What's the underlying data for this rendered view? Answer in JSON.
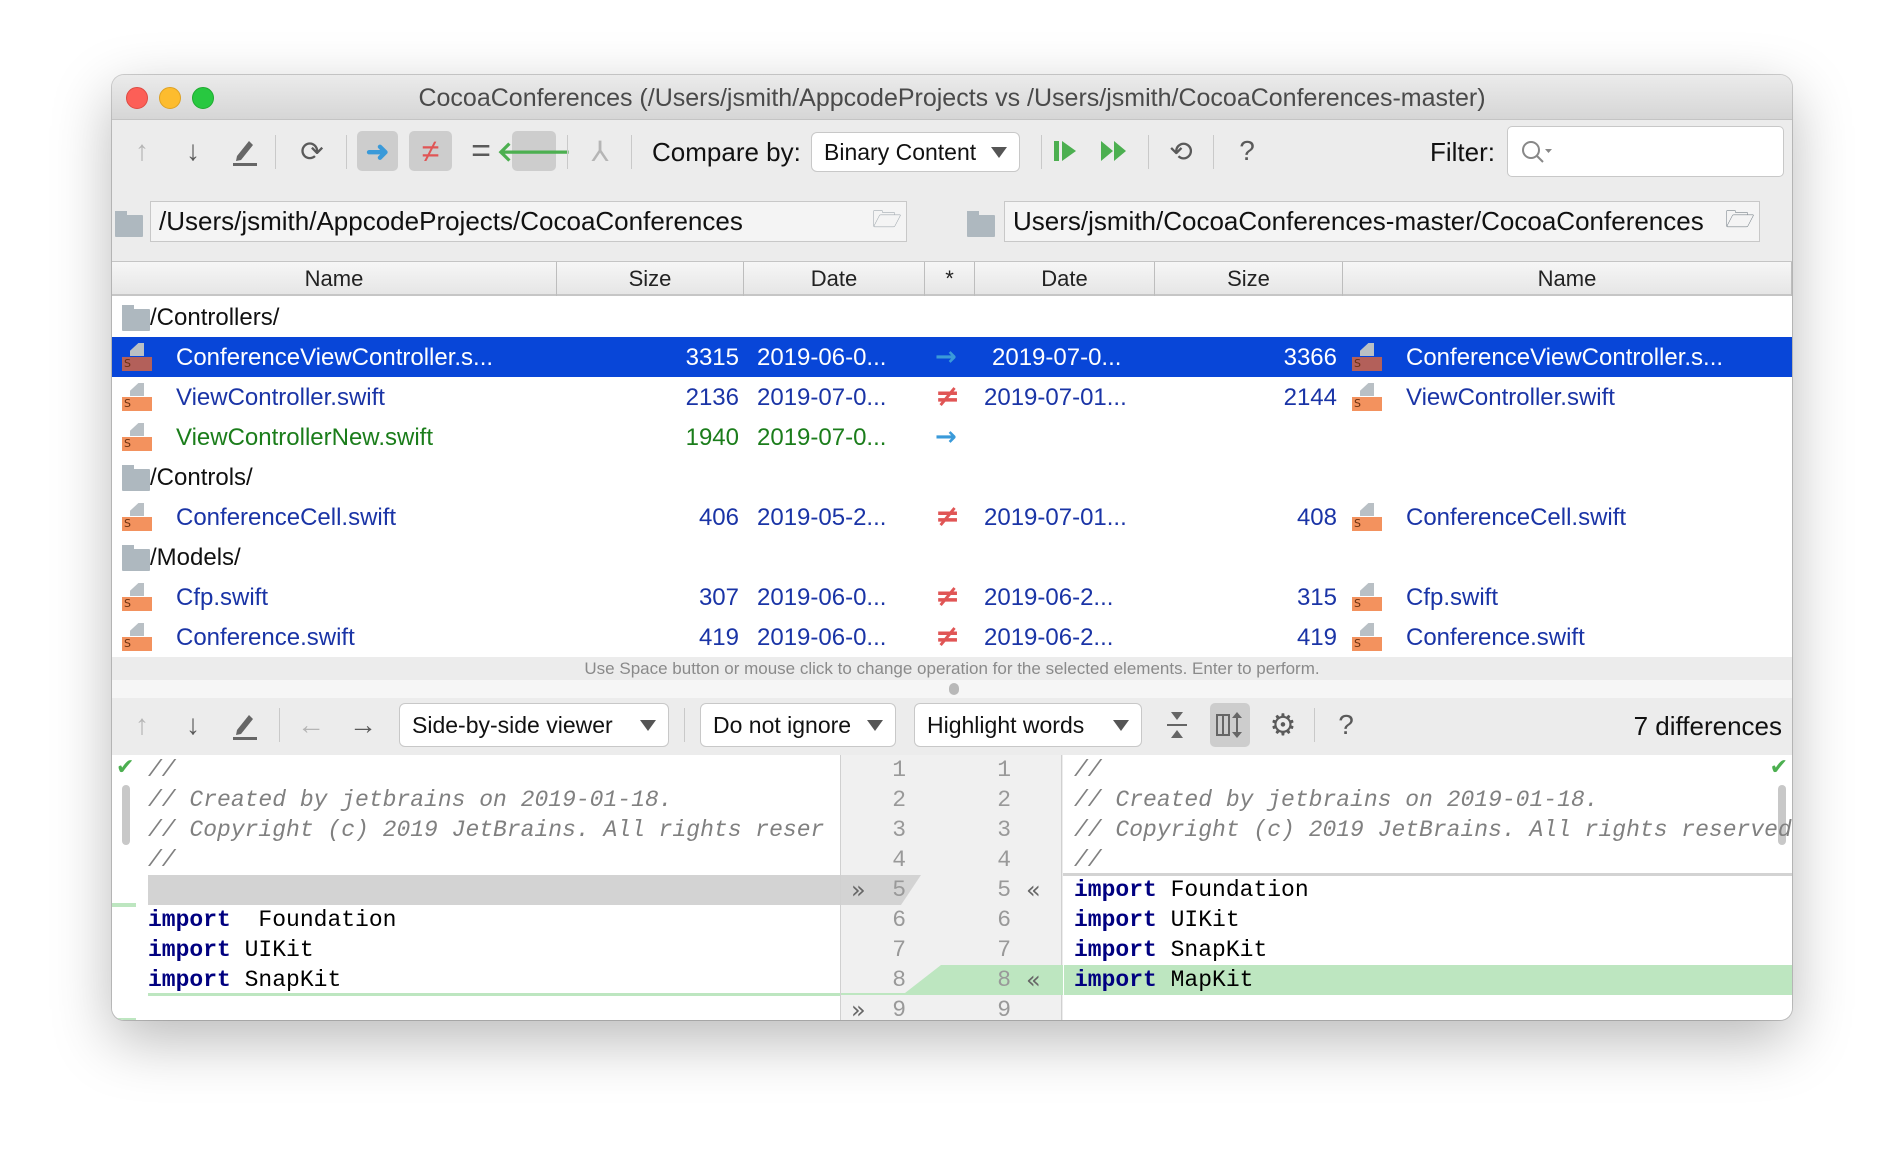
{
  "window": {
    "title": "CocoaConferences (/Users/jsmith/AppcodeProjects vs /Users/jsmith/CocoaConferences-master)"
  },
  "colors": {
    "selection": "#0846d8",
    "changed_text": "#1a34a6",
    "new_text": "#1b7d1b",
    "arrow": "#3a9ad9",
    "not_equal": "#e05555",
    "left_arrow": "#4caf50",
    "inserted_bg": "#bde6c0"
  },
  "toolbar": {
    "compare_label": "Compare by:",
    "compare_value": "Binary Content",
    "filter_label": "Filter:",
    "filter_value": "",
    "icons": [
      "arrow-up-icon",
      "arrow-down-icon",
      "edit-icon",
      "refresh-icon",
      "show-left-only-icon",
      "show-different-icon",
      "show-equal-icon",
      "show-right-only-icon",
      "merge-icon",
      "synchronize-selected-icon",
      "synchronize-all-icon",
      "compare-sync-icon",
      "help-icon"
    ]
  },
  "paths": {
    "left": "/Users/jsmith/AppcodeProjects/CocoaConferences",
    "right": "Users/jsmith/CocoaConferences-master/CocoaConferences"
  },
  "table": {
    "headers": [
      "Name",
      "Size",
      "Date",
      "*",
      "Date",
      "Size",
      "Name"
    ],
    "rows": [
      {
        "type": "folder",
        "name": "/Controllers/"
      },
      {
        "type": "file",
        "status": "selected",
        "lname": "ConferenceViewController.s...",
        "lsize": "3315",
        "ldate": "2019-06-0...",
        "op": "→",
        "rdate": "2019-07-0...",
        "rsize": "3366",
        "rname": "ConferenceViewController.s..."
      },
      {
        "type": "file",
        "status": "changed",
        "lname": "ViewController.swift",
        "lsize": "2136",
        "ldate": "2019-07-0...",
        "op": "≠",
        "rdate": "2019-07-01...",
        "rsize": "2144",
        "rname": "ViewController.swift"
      },
      {
        "type": "file",
        "status": "new",
        "lname": "ViewControllerNew.swift",
        "lsize": "1940",
        "ldate": "2019-07-0...",
        "op": "→",
        "rdate": "",
        "rsize": "",
        "rname": ""
      },
      {
        "type": "folder",
        "name": "/Controls/"
      },
      {
        "type": "file",
        "status": "changed",
        "lname": "ConferenceCell.swift",
        "lsize": "406",
        "ldate": "2019-05-2...",
        "op": "≠",
        "rdate": "2019-07-01...",
        "rsize": "408",
        "rname": "ConferenceCell.swift"
      },
      {
        "type": "folder",
        "name": "/Models/"
      },
      {
        "type": "file",
        "status": "changed",
        "lname": "Cfp.swift",
        "lsize": "307",
        "ldate": "2019-06-0...",
        "op": "≠",
        "rdate": "2019-06-2...",
        "rsize": "315",
        "rname": "Cfp.swift"
      },
      {
        "type": "file",
        "status": "changed",
        "lname": "Conference.swift",
        "lsize": "419",
        "ldate": "2019-06-0...",
        "op": "≠",
        "rdate": "2019-06-2...",
        "rsize": "419",
        "rname": "Conference.swift"
      }
    ]
  },
  "hint": "Use Space button or mouse click to change operation for the selected elements. Enter to perform.",
  "diff_toolbar": {
    "viewer": "Side-by-side viewer",
    "ignore": "Do not ignore",
    "highlight": "Highlight words",
    "differences": "7 differences"
  },
  "diff": {
    "left": [
      {
        "n": "1",
        "parts": [
          [
            "cm",
            "//"
          ]
        ]
      },
      {
        "n": "2",
        "parts": [
          [
            "cm",
            "// Created by jetbrains on 2019-01-18."
          ]
        ]
      },
      {
        "n": "3",
        "parts": [
          [
            "cm",
            "// Copyright (c) 2019 JetBrains. All rights reser"
          ]
        ]
      },
      {
        "n": "4",
        "parts": [
          [
            "cm",
            "//"
          ]
        ]
      },
      {
        "n": "5",
        "parts": [],
        "bg": "deleted"
      },
      {
        "n": "6",
        "parts": [
          [
            "kw",
            "import"
          ],
          [
            "",
            "  Foundation"
          ]
        ]
      },
      {
        "n": "7",
        "parts": [
          [
            "kw",
            "import"
          ],
          [
            "",
            " UIKit"
          ]
        ]
      },
      {
        "n": "8",
        "parts": [
          [
            "kw",
            "import"
          ],
          [
            "",
            " SnapKit"
          ]
        ]
      },
      {
        "n": "9",
        "parts": []
      }
    ],
    "right": [
      {
        "n": "1",
        "parts": [
          [
            "cm",
            "//"
          ]
        ]
      },
      {
        "n": "2",
        "parts": [
          [
            "cm",
            "// Created by jetbrains on 2019-01-18."
          ]
        ]
      },
      {
        "n": "3",
        "parts": [
          [
            "cm",
            "// Copyright (c) 2019 JetBrains. All rights reserved"
          ]
        ]
      },
      {
        "n": "4",
        "parts": [
          [
            "cm",
            "//"
          ]
        ]
      },
      {
        "n": "5",
        "parts": [
          [
            "kw",
            "import"
          ],
          [
            "",
            " Foundation"
          ]
        ]
      },
      {
        "n": "6",
        "parts": [
          [
            "kw",
            "import"
          ],
          [
            "",
            " UIKit"
          ]
        ]
      },
      {
        "n": "7",
        "parts": [
          [
            "kw",
            "import"
          ],
          [
            "",
            " SnapKit"
          ]
        ]
      },
      {
        "n": "8",
        "parts": [
          [
            "kw",
            "import"
          ],
          [
            "",
            " MapKit"
          ]
        ],
        "bg": "inserted"
      },
      {
        "n": "9",
        "parts": []
      }
    ]
  }
}
